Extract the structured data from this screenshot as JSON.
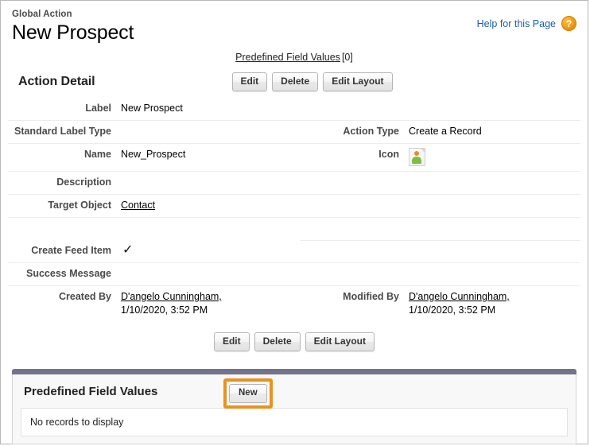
{
  "header": {
    "eyebrow": "Global Action",
    "title": "New Prospect",
    "help_label": "Help for this Page",
    "help_icon": "question-mark-icon",
    "help_icon_glyph": "?",
    "help_link_color": "#1b5faa",
    "help_badge_color": "#f0920a"
  },
  "related_nav": {
    "link_label": "Predefined Field Values",
    "count_label": "[0]"
  },
  "detail": {
    "section_title": "Action Detail",
    "buttons": [
      {
        "label": "Edit",
        "name": "edit-button"
      },
      {
        "label": "Delete",
        "name": "delete-button"
      },
      {
        "label": "Edit Layout",
        "name": "edit-layout-button"
      }
    ],
    "rows": [
      {
        "left_label": "Label",
        "left_value": "New Prospect",
        "right_label": "",
        "right_value": ""
      },
      {
        "left_label": "Standard Label Type",
        "left_value": "",
        "right_label": "Action Type",
        "right_value": "Create a Record"
      },
      {
        "left_label": "Name",
        "left_value": "New_Prospect",
        "right_label": "Icon",
        "right_value": "",
        "right_icon": "action-icon-thumbnail"
      },
      {
        "left_label": "Description",
        "left_value": "",
        "right_label": "",
        "right_value": ""
      },
      {
        "left_label": "Target Object",
        "left_value": "Contact",
        "left_value_is_link": true,
        "right_label": "",
        "right_value": ""
      },
      {
        "left_label": "Create Feed Item",
        "left_value": "checked",
        "check_glyph": "✓",
        "right_label": "",
        "right_value": ""
      },
      {
        "left_label": "Success Message",
        "left_value": "",
        "right_label": "",
        "right_value": ""
      },
      {
        "left_label": "Created By",
        "left_value": "D'angelo Cunningham,",
        "left_value_sub": "1/10/2020, 3:52 PM",
        "right_label": "Modified By",
        "right_value": "D'angelo Cunningham,",
        "right_value_sub": "1/10/2020, 3:52 PM"
      }
    ]
  },
  "bottom_buttons": [
    {
      "label": "Edit",
      "name": "edit-button-bottom"
    },
    {
      "label": "Delete",
      "name": "delete-button-bottom"
    },
    {
      "label": "Edit Layout",
      "name": "edit-layout-button-bottom"
    }
  ],
  "related_list": {
    "title": "Predefined Field Values",
    "new_button_label": "New",
    "empty_message": "No records to display",
    "highlight_color": "#e8921f",
    "topbar_color": "#73738c"
  }
}
